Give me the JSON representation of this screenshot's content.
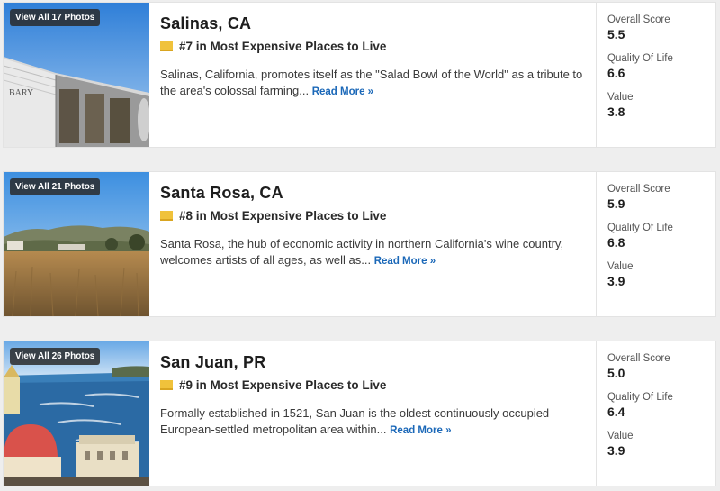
{
  "places": [
    {
      "photos_label": "View All 17 Photos",
      "name": "Salinas, CA",
      "rank": "#7 in Most Expensive Places to Live",
      "description": "Salinas, California, promotes itself as the \"Salad Bowl of the World\" as a tribute to the area's colossal farming...",
      "read_more": "Read More »",
      "scores": [
        {
          "label": "Overall Score",
          "value": "5.5"
        },
        {
          "label": "Quality Of Life",
          "value": "6.6"
        },
        {
          "label": "Value",
          "value": "3.8"
        }
      ],
      "photo_text": "BARY"
    },
    {
      "photos_label": "View All 21 Photos",
      "name": "Santa Rosa, CA",
      "rank": "#8 in Most Expensive Places to Live",
      "description": "Santa Rosa, the hub of economic activity in northern California's wine country, welcomes artists of all ages, as well as...",
      "read_more": "Read More »",
      "scores": [
        {
          "label": "Overall Score",
          "value": "5.9"
        },
        {
          "label": "Quality Of Life",
          "value": "6.8"
        },
        {
          "label": "Value",
          "value": "3.9"
        }
      ]
    },
    {
      "photos_label": "View All 26 Photos",
      "name": "San Juan, PR",
      "rank": "#9 in Most Expensive Places to Live",
      "description": "Formally established in 1521, San Juan is the oldest continuously occupied European-settled metropolitan area within...",
      "read_more": "Read More »",
      "scores": [
        {
          "label": "Overall Score",
          "value": "5.0"
        },
        {
          "label": "Quality Of Life",
          "value": "6.4"
        },
        {
          "label": "Value",
          "value": "3.9"
        }
      ]
    }
  ],
  "colors": {
    "link": "#1b68b8",
    "ribbon": "#f0c23b"
  },
  "icons": [
    "ribbon-icon"
  ]
}
